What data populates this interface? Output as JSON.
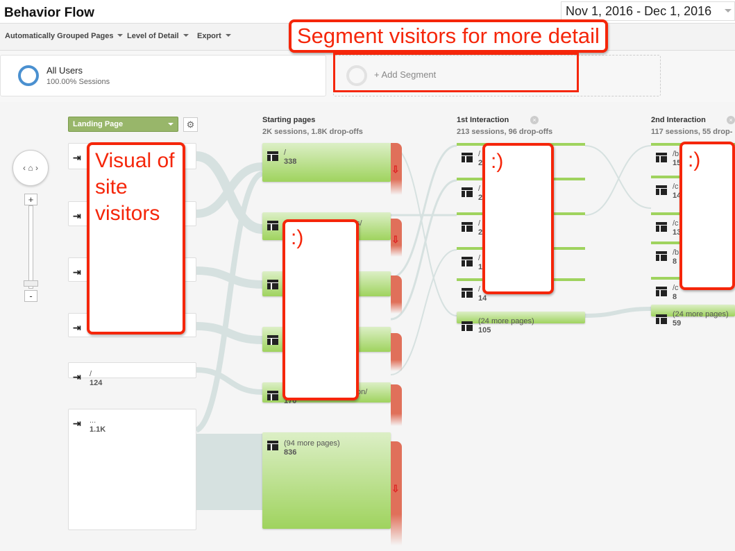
{
  "header": {
    "title": "Behavior Flow",
    "date_range": "Nov 1, 2016 - Dec 1, 2016"
  },
  "toolbar": {
    "grouped": "Automatically Grouped Pages",
    "detail": "Level of Detail",
    "export": "Export"
  },
  "segments": {
    "all_users": "All Users",
    "all_users_pct": "100.00% Sessions",
    "add": "+ Add Segment"
  },
  "landing": {
    "selector": "Landing Page",
    "nodes": [
      {
        "label": "/",
        "value": "124"
      },
      {
        "label": "...",
        "value": "1.1K"
      }
    ]
  },
  "starting": {
    "title": "Starting pages",
    "stats": "2K sessions, 1.8K drop-offs",
    "nodes": [
      {
        "label": "/",
        "value": "338"
      },
      {
        "label": "s/",
        "value": ""
      },
      {
        "label": "/",
        "value": ""
      },
      {
        "label": "/",
        "value": ""
      },
      {
        "label": "on/",
        "value": "170"
      },
      {
        "label": "(94 more pages)",
        "value": "836"
      }
    ]
  },
  "first": {
    "title": "1st Interaction",
    "stats": "213 sessions, 96 drop-offs",
    "nodes": [
      {
        "label": "/",
        "value": "2"
      },
      {
        "label": "/",
        "value": "2"
      },
      {
        "label": "/",
        "value": "2"
      },
      {
        "label": "/",
        "value": "1"
      },
      {
        "label": "/",
        "value": "14"
      },
      {
        "label": "(24 more pages)",
        "value": "105"
      }
    ]
  },
  "second": {
    "title": "2nd Interaction",
    "stats": "117 sessions, 55 drop-",
    "nodes": [
      {
        "label": "/b",
        "value": "15"
      },
      {
        "label": "/c",
        "value": "14"
      },
      {
        "label": "/c",
        "value": "13"
      },
      {
        "label": "/b",
        "value": "8"
      },
      {
        "label": "/c",
        "value": "8"
      },
      {
        "label": "(24 more pages)",
        "value": "59"
      }
    ]
  },
  "annotations": {
    "segment": "Segment visitors for more detail",
    "visual": "Visual of site visitors",
    "smile": ":)"
  }
}
